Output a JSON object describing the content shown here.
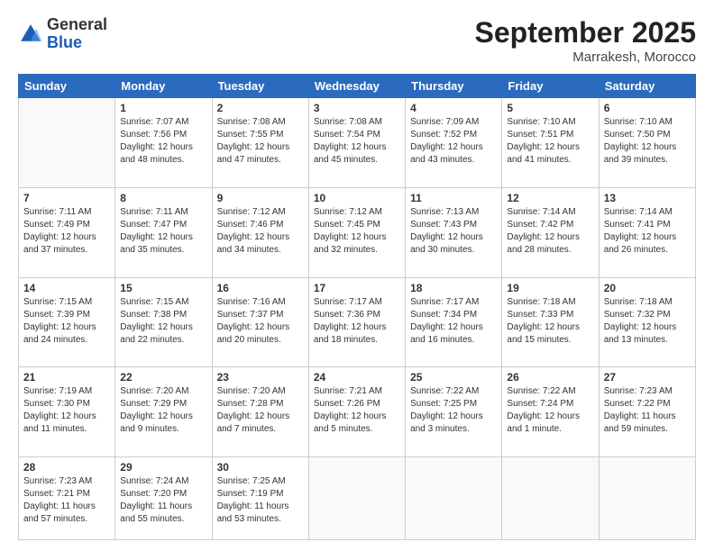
{
  "header": {
    "logo_general": "General",
    "logo_blue": "Blue",
    "month_title": "September 2025",
    "subtitle": "Marrakesh, Morocco"
  },
  "days_of_week": [
    "Sunday",
    "Monday",
    "Tuesday",
    "Wednesday",
    "Thursday",
    "Friday",
    "Saturday"
  ],
  "weeks": [
    [
      {
        "day": "",
        "info": ""
      },
      {
        "day": "1",
        "info": "Sunrise: 7:07 AM\nSunset: 7:56 PM\nDaylight: 12 hours\nand 48 minutes."
      },
      {
        "day": "2",
        "info": "Sunrise: 7:08 AM\nSunset: 7:55 PM\nDaylight: 12 hours\nand 47 minutes."
      },
      {
        "day": "3",
        "info": "Sunrise: 7:08 AM\nSunset: 7:54 PM\nDaylight: 12 hours\nand 45 minutes."
      },
      {
        "day": "4",
        "info": "Sunrise: 7:09 AM\nSunset: 7:52 PM\nDaylight: 12 hours\nand 43 minutes."
      },
      {
        "day": "5",
        "info": "Sunrise: 7:10 AM\nSunset: 7:51 PM\nDaylight: 12 hours\nand 41 minutes."
      },
      {
        "day": "6",
        "info": "Sunrise: 7:10 AM\nSunset: 7:50 PM\nDaylight: 12 hours\nand 39 minutes."
      }
    ],
    [
      {
        "day": "7",
        "info": "Sunrise: 7:11 AM\nSunset: 7:49 PM\nDaylight: 12 hours\nand 37 minutes."
      },
      {
        "day": "8",
        "info": "Sunrise: 7:11 AM\nSunset: 7:47 PM\nDaylight: 12 hours\nand 35 minutes."
      },
      {
        "day": "9",
        "info": "Sunrise: 7:12 AM\nSunset: 7:46 PM\nDaylight: 12 hours\nand 34 minutes."
      },
      {
        "day": "10",
        "info": "Sunrise: 7:12 AM\nSunset: 7:45 PM\nDaylight: 12 hours\nand 32 minutes."
      },
      {
        "day": "11",
        "info": "Sunrise: 7:13 AM\nSunset: 7:43 PM\nDaylight: 12 hours\nand 30 minutes."
      },
      {
        "day": "12",
        "info": "Sunrise: 7:14 AM\nSunset: 7:42 PM\nDaylight: 12 hours\nand 28 minutes."
      },
      {
        "day": "13",
        "info": "Sunrise: 7:14 AM\nSunset: 7:41 PM\nDaylight: 12 hours\nand 26 minutes."
      }
    ],
    [
      {
        "day": "14",
        "info": "Sunrise: 7:15 AM\nSunset: 7:39 PM\nDaylight: 12 hours\nand 24 minutes."
      },
      {
        "day": "15",
        "info": "Sunrise: 7:15 AM\nSunset: 7:38 PM\nDaylight: 12 hours\nand 22 minutes."
      },
      {
        "day": "16",
        "info": "Sunrise: 7:16 AM\nSunset: 7:37 PM\nDaylight: 12 hours\nand 20 minutes."
      },
      {
        "day": "17",
        "info": "Sunrise: 7:17 AM\nSunset: 7:36 PM\nDaylight: 12 hours\nand 18 minutes."
      },
      {
        "day": "18",
        "info": "Sunrise: 7:17 AM\nSunset: 7:34 PM\nDaylight: 12 hours\nand 16 minutes."
      },
      {
        "day": "19",
        "info": "Sunrise: 7:18 AM\nSunset: 7:33 PM\nDaylight: 12 hours\nand 15 minutes."
      },
      {
        "day": "20",
        "info": "Sunrise: 7:18 AM\nSunset: 7:32 PM\nDaylight: 12 hours\nand 13 minutes."
      }
    ],
    [
      {
        "day": "21",
        "info": "Sunrise: 7:19 AM\nSunset: 7:30 PM\nDaylight: 12 hours\nand 11 minutes."
      },
      {
        "day": "22",
        "info": "Sunrise: 7:20 AM\nSunset: 7:29 PM\nDaylight: 12 hours\nand 9 minutes."
      },
      {
        "day": "23",
        "info": "Sunrise: 7:20 AM\nSunset: 7:28 PM\nDaylight: 12 hours\nand 7 minutes."
      },
      {
        "day": "24",
        "info": "Sunrise: 7:21 AM\nSunset: 7:26 PM\nDaylight: 12 hours\nand 5 minutes."
      },
      {
        "day": "25",
        "info": "Sunrise: 7:22 AM\nSunset: 7:25 PM\nDaylight: 12 hours\nand 3 minutes."
      },
      {
        "day": "26",
        "info": "Sunrise: 7:22 AM\nSunset: 7:24 PM\nDaylight: 12 hours\nand 1 minute."
      },
      {
        "day": "27",
        "info": "Sunrise: 7:23 AM\nSunset: 7:22 PM\nDaylight: 11 hours\nand 59 minutes."
      }
    ],
    [
      {
        "day": "28",
        "info": "Sunrise: 7:23 AM\nSunset: 7:21 PM\nDaylight: 11 hours\nand 57 minutes."
      },
      {
        "day": "29",
        "info": "Sunrise: 7:24 AM\nSunset: 7:20 PM\nDaylight: 11 hours\nand 55 minutes."
      },
      {
        "day": "30",
        "info": "Sunrise: 7:25 AM\nSunset: 7:19 PM\nDaylight: 11 hours\nand 53 minutes."
      },
      {
        "day": "",
        "info": ""
      },
      {
        "day": "",
        "info": ""
      },
      {
        "day": "",
        "info": ""
      },
      {
        "day": "",
        "info": ""
      }
    ]
  ]
}
